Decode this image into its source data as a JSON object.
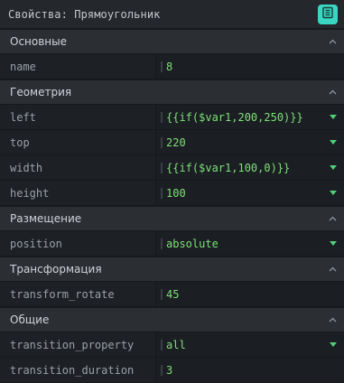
{
  "header": {
    "title": "Свойства: Прямоугольник",
    "action_icon": "document-list-icon",
    "accent": "#3ad6c2"
  },
  "sections": {
    "basic": {
      "title": "Основные"
    },
    "geometry": {
      "title": "Геометрия"
    },
    "placement": {
      "title": "Размещение"
    },
    "transform": {
      "title": "Трансформация"
    },
    "common": {
      "title": "Общие"
    }
  },
  "props": {
    "name": {
      "label": "name",
      "value": "8"
    },
    "left": {
      "label": "left",
      "value": "{{if($var1,200,250)}}"
    },
    "top": {
      "label": "top",
      "value": "220"
    },
    "width": {
      "label": "width",
      "value": "{{if($var1,100,0)}}"
    },
    "height": {
      "label": "height",
      "value": "100"
    },
    "position": {
      "label": "position",
      "value": "absolute"
    },
    "transform_rotate": {
      "label": "transform_rotate",
      "value": "45"
    },
    "transition_property": {
      "label": "transition_property",
      "value": "all"
    },
    "transition_duration": {
      "label": "transition_duration",
      "value": "3"
    }
  },
  "colors": {
    "value_text": "#7ee07a",
    "dropdown_arrow": "#4fd17a"
  }
}
